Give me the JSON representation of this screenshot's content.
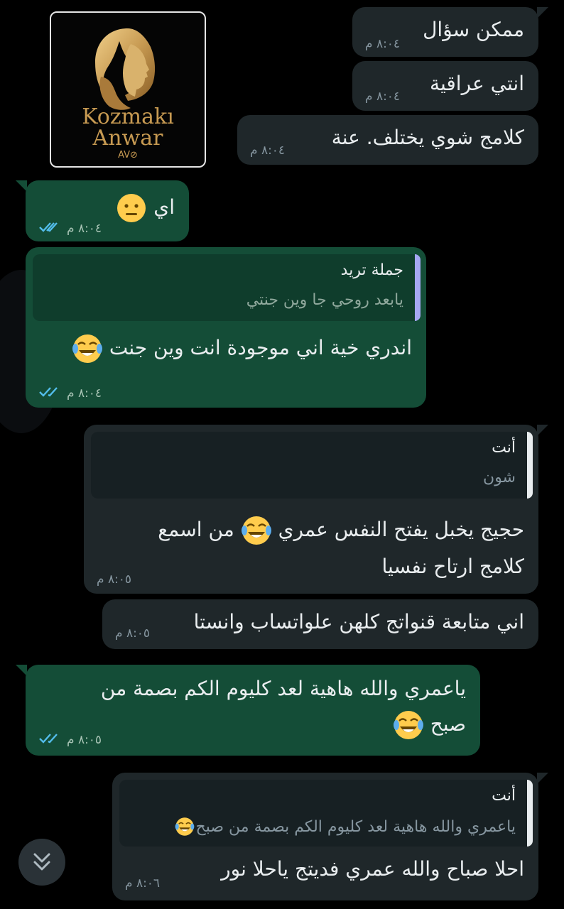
{
  "logo": {
    "line1": "Kozmakı",
    "line2": "Anwar",
    "line3": "AV⊘"
  },
  "messages": [
    {
      "text": "ممكن سؤال",
      "time": "٨:٠٤ م"
    },
    {
      "text": "انتي عراقية",
      "time": "٨:٠٤ م"
    },
    {
      "text": "كلامج شوي  يختلف. عنة",
      "time": "٨:٠٤ م"
    },
    {
      "text": "اي",
      "time": "٨:٠٤ م",
      "emoji": "neutral-face"
    },
    {
      "quote_author": "جملة تريد",
      "quote_text": "يابعد روحي جا وين جنتي",
      "text": "اندري خية اني موجودة انت وين جنت",
      "time": "٨:٠٤ م",
      "emoji": "tears-of-joy"
    },
    {
      "quote_author": "أنت",
      "quote_text": "شون",
      "line1_before": "من اسمع",
      "line1_after": "حجيج يخبل يفتح النفس عمري",
      "line2": "كلامج ارتاح نفسيا",
      "time": "٨:٠٥ م"
    },
    {
      "text": "اني متابعة قنواتج كلهن علواتساب وانستا",
      "time": "٨:٠٥ م"
    },
    {
      "line1": "ياعمري والله هاهية لعد كليوم الكم بصمة من",
      "line2": "صبح",
      "time": "٨:٠٥ م"
    },
    {
      "quote_author": "أنت",
      "quote_text": "ياعمري والله هاهية لعد كليوم الكم بصمة من صبح",
      "text": "احلا صباح والله عمري فديتج ياحلا نور",
      "time": "٨:٠٦ م"
    }
  ],
  "colors": {
    "incoming_bubble": "#1f272a",
    "outgoing_bubble": "#144d37",
    "read_ticks": "#53bdeb",
    "quote_bar_purple": "#a5a7f2",
    "quote_bar_white": "#e9edef",
    "logo_gold": "#c79a52"
  }
}
